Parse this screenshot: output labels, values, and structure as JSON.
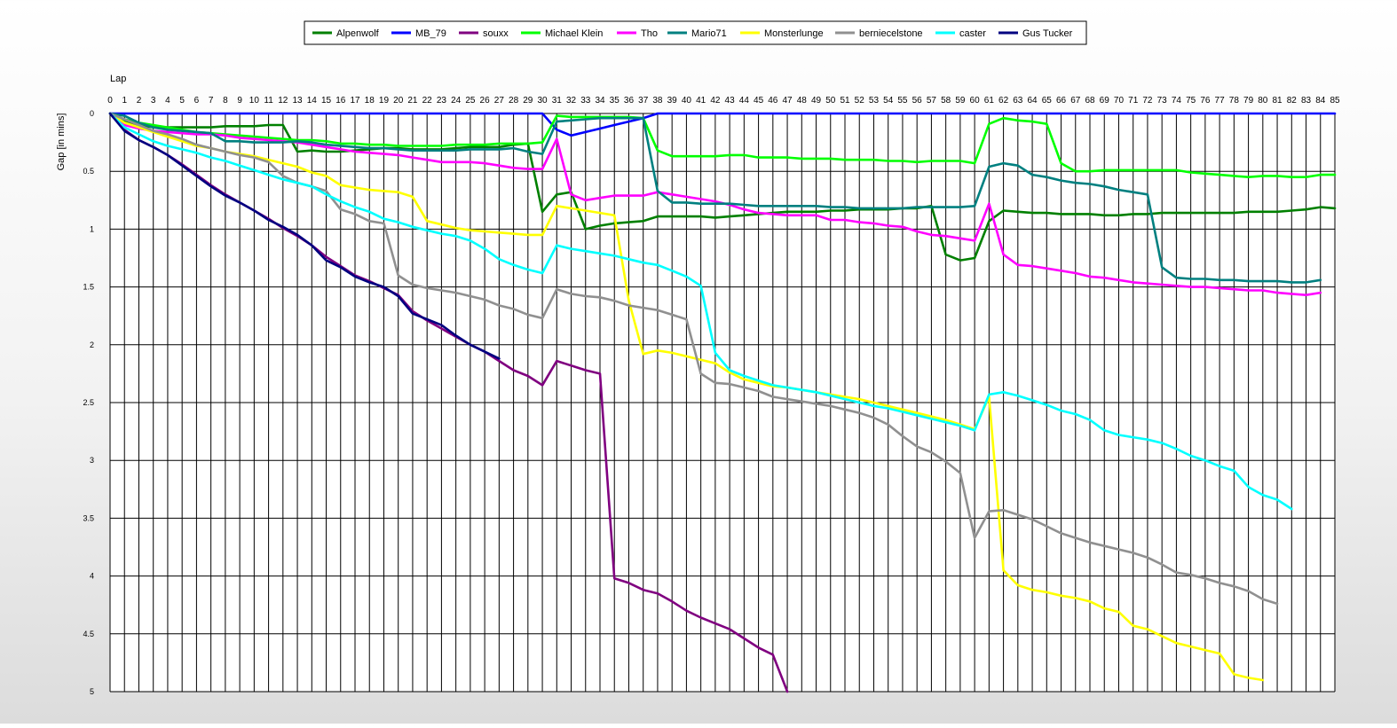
{
  "chart_data": {
    "type": "line",
    "title": "",
    "xlabel": "Lap",
    "ylabel": "Gap [in mins]",
    "x_ticks": [
      "0",
      "1",
      "2",
      "3",
      "4",
      "5",
      "6",
      "7",
      "8",
      "9",
      "10",
      "11",
      "12",
      "13",
      "14",
      "15",
      "16",
      "17",
      "18",
      "19",
      "20",
      "21",
      "22",
      "23",
      "24",
      "25",
      "26",
      "27",
      "28",
      "29",
      "30",
      "31",
      "32",
      "33",
      "34",
      "35",
      "36",
      "37",
      "38",
      "39",
      "40",
      "41",
      "42",
      "43",
      "44",
      "45",
      "46",
      "47",
      "48",
      "49",
      "50",
      "51",
      "52",
      "53",
      "54",
      "55",
      "56",
      "57",
      "58",
      "59",
      "60",
      "61",
      "62",
      "63",
      "64",
      "65",
      "66",
      "67",
      "68",
      "69",
      "70",
      "71",
      "72",
      "73",
      "74",
      "75",
      "76",
      "77",
      "78",
      "79",
      "80",
      "81",
      "82",
      "83",
      "84",
      "85"
    ],
    "y_ticks": [
      "0",
      "0.5",
      "1",
      "1.5",
      "2",
      "2.5",
      "3",
      "3.5",
      "4",
      "4.5",
      "5"
    ],
    "xlim": [
      0,
      85
    ],
    "ylim": [
      0,
      5
    ],
    "y_inverted": true,
    "grid": true,
    "legend_position": "top-center",
    "series": [
      {
        "name": "Alpenwolf",
        "color": "#008000",
        "values": [
          0,
          0.07,
          0.1,
          0.12,
          0.12,
          0.12,
          0.12,
          0.12,
          0.11,
          0.11,
          0.11,
          0.1,
          0.1,
          0.33,
          0.32,
          0.33,
          0.33,
          0.32,
          0.31,
          0.3,
          0.3,
          0.31,
          0.31,
          0.31,
          0.3,
          0.29,
          0.29,
          0.29,
          0.27,
          0.26,
          0.85,
          0.7,
          0.68,
          1,
          0.97,
          0.95,
          0.94,
          0.93,
          0.89,
          0.89,
          0.89,
          0.89,
          0.9,
          0.89,
          0.88,
          0.87,
          0.86,
          0.85,
          0.85,
          0.85,
          0.84,
          0.84,
          0.83,
          0.83,
          0.83,
          0.82,
          0.82,
          0.8,
          1.22,
          1.27,
          1.25,
          0.93,
          0.84,
          0.85,
          0.86,
          0.86,
          0.87,
          0.87,
          0.87,
          0.88,
          0.88,
          0.87,
          0.87,
          0.86,
          0.86,
          0.86,
          0.86,
          0.86,
          0.86,
          0.85,
          0.85,
          0.85,
          0.84,
          0.83,
          0.81,
          0.82
        ]
      },
      {
        "name": "MB_79",
        "color": "#0000ff",
        "values": [
          0,
          0,
          0,
          0,
          0,
          0,
          0,
          0,
          0,
          0,
          0,
          0,
          0,
          0,
          0,
          0,
          0,
          0,
          0,
          0,
          0,
          0,
          0,
          0,
          0,
          0,
          0,
          0,
          0,
          0,
          0,
          0.14,
          0.19,
          0.16,
          0.13,
          0.1,
          0.07,
          0.04,
          0,
          0,
          0,
          0,
          0,
          0,
          0,
          0,
          0,
          0,
          0,
          0,
          0,
          0,
          0,
          0,
          0,
          0,
          0,
          0,
          0,
          0,
          0,
          0,
          0,
          0,
          0,
          0,
          0,
          0,
          0,
          0,
          0,
          0,
          0,
          0,
          0,
          0,
          0,
          0,
          0,
          0,
          0,
          0,
          0,
          0,
          0,
          0
        ]
      },
      {
        "name": "souxx",
        "color": "#800080",
        "values": [
          0,
          0.14,
          0.23,
          0.29,
          0.36,
          0.44,
          0.53,
          0.62,
          0.7,
          0.77,
          0.84,
          0.91,
          0.99,
          1.06,
          1.14,
          1.24,
          1.32,
          1.4,
          1.45,
          1.51,
          1.57,
          1.71,
          1.79,
          1.86,
          1.93,
          2,
          2.06,
          2.14,
          2.22,
          2.27,
          2.35,
          2.14,
          2.18,
          2.22,
          2.25,
          4.02,
          4.06,
          4.12,
          4.15,
          4.22,
          4.3,
          4.36,
          4.41,
          4.46,
          4.54,
          4.62,
          4.68,
          5.0
        ]
      },
      {
        "name": "Michael Klein",
        "color": "#00ff00",
        "values": [
          0,
          0.05,
          0.08,
          0.1,
          0.12,
          0.14,
          0.16,
          0.17,
          0.18,
          0.19,
          0.2,
          0.21,
          0.22,
          0.23,
          0.23,
          0.24,
          0.26,
          0.26,
          0.27,
          0.27,
          0.28,
          0.28,
          0.28,
          0.28,
          0.27,
          0.27,
          0.27,
          0.26,
          0.26,
          0.26,
          0.25,
          0.02,
          0.03,
          0.03,
          0.03,
          0.03,
          0.03,
          0.04,
          0.32,
          0.37,
          0.37,
          0.37,
          0.37,
          0.36,
          0.36,
          0.38,
          0.38,
          0.38,
          0.39,
          0.39,
          0.39,
          0.4,
          0.4,
          0.4,
          0.41,
          0.41,
          0.42,
          0.41,
          0.41,
          0.41,
          0.43,
          0.09,
          0.04,
          0.06,
          0.07,
          0.09,
          0.43,
          0.5,
          0.5,
          0.49,
          0.49,
          0.49,
          0.49,
          0.49,
          0.49,
          0.51,
          0.52,
          0.53,
          0.54,
          0.55,
          0.54,
          0.54,
          0.55,
          0.55,
          0.53,
          0.53
        ]
      },
      {
        "name": "Tho",
        "color": "#ff00ff",
        "values": [
          0,
          0.1,
          0.13,
          0.15,
          0.16,
          0.17,
          0.18,
          0.18,
          0.19,
          0.21,
          0.22,
          0.23,
          0.24,
          0.25,
          0.27,
          0.29,
          0.31,
          0.33,
          0.34,
          0.35,
          0.36,
          0.38,
          0.4,
          0.42,
          0.42,
          0.42,
          0.43,
          0.45,
          0.47,
          0.48,
          0.48,
          0.22,
          0.7,
          0.75,
          0.73,
          0.71,
          0.71,
          0.71,
          0.68,
          0.7,
          0.72,
          0.74,
          0.76,
          0.79,
          0.83,
          0.86,
          0.87,
          0.88,
          0.88,
          0.88,
          0.92,
          0.92,
          0.94,
          0.95,
          0.97,
          0.98,
          1.02,
          1.05,
          1.06,
          1.08,
          1.1,
          0.78,
          1.22,
          1.31,
          1.32,
          1.34,
          1.36,
          1.38,
          1.41,
          1.42,
          1.44,
          1.46,
          1.47,
          1.48,
          1.49,
          1.5,
          1.5,
          1.51,
          1.52,
          1.53,
          1.53,
          1.55,
          1.56,
          1.57,
          1.55
        ]
      },
      {
        "name": "Mario71",
        "color": "#008080",
        "values": [
          0,
          0.02,
          0.08,
          0.12,
          0.14,
          0.15,
          0.16,
          0.17,
          0.24,
          0.24,
          0.25,
          0.25,
          0.25,
          0.24,
          0.25,
          0.27,
          0.28,
          0.29,
          0.3,
          0.3,
          0.31,
          0.32,
          0.32,
          0.32,
          0.32,
          0.31,
          0.31,
          0.31,
          0.3,
          0.33,
          0.35,
          0.07,
          0.06,
          0.05,
          0.04,
          0.04,
          0.04,
          0.04,
          0.67,
          0.77,
          0.77,
          0.78,
          0.78,
          0.78,
          0.79,
          0.8,
          0.8,
          0.8,
          0.8,
          0.8,
          0.81,
          0.81,
          0.82,
          0.82,
          0.82,
          0.82,
          0.81,
          0.81,
          0.81,
          0.81,
          0.8,
          0.46,
          0.43,
          0.45,
          0.53,
          0.55,
          0.58,
          0.6,
          0.61,
          0.63,
          0.66,
          0.68,
          0.7,
          1.33,
          1.42,
          1.43,
          1.43,
          1.44,
          1.44,
          1.45,
          1.45,
          1.45,
          1.46,
          1.46,
          1.44
        ]
      },
      {
        "name": "Monsterlunge",
        "color": "#ffff00",
        "values": [
          0,
          0.08,
          0.12,
          0.16,
          0.2,
          0.24,
          0.28,
          0.3,
          0.33,
          0.35,
          0.37,
          0.4,
          0.43,
          0.46,
          0.51,
          0.54,
          0.62,
          0.64,
          0.66,
          0.67,
          0.68,
          0.72,
          0.93,
          0.96,
          0.99,
          1.01,
          1.02,
          1.03,
          1.04,
          1.05,
          1.05,
          0.8,
          0.82,
          0.84,
          0.86,
          0.88,
          1.62,
          2.08,
          2.05,
          2.07,
          2.1,
          2.13,
          2.16,
          2.24,
          2.3,
          2.33,
          2.36,
          2.37,
          2.39,
          2.41,
          2.43,
          2.45,
          2.47,
          2.5,
          2.53,
          2.56,
          2.59,
          2.62,
          2.65,
          2.69,
          2.73,
          2.45,
          3.95,
          4.08,
          4.12,
          4.14,
          4.17,
          4.19,
          4.22,
          4.28,
          4.31,
          4.43,
          4.46,
          4.52,
          4.58,
          4.61,
          4.64,
          4.67,
          4.85,
          4.88,
          4.9
        ]
      },
      {
        "name": "berniecelstone",
        "color": "#909090",
        "values": [
          0,
          0.05,
          0.1,
          0.15,
          0.18,
          0.22,
          0.27,
          0.3,
          0.33,
          0.36,
          0.38,
          0.42,
          0.54,
          0.6,
          0.63,
          0.67,
          0.83,
          0.87,
          0.93,
          0.95,
          1.4,
          1.48,
          1.51,
          1.53,
          1.55,
          1.58,
          1.61,
          1.66,
          1.69,
          1.74,
          1.77,
          1.52,
          1.56,
          1.58,
          1.59,
          1.62,
          1.66,
          1.68,
          1.7,
          1.74,
          1.78,
          2.25,
          2.33,
          2.34,
          2.37,
          2.4,
          2.45,
          2.47,
          2.49,
          2.51,
          2.53,
          2.56,
          2.59,
          2.63,
          2.69,
          2.79,
          2.88,
          2.93,
          3.01,
          3.11,
          3.67,
          3.44,
          3.43,
          3.47,
          3.51,
          3.57,
          3.63,
          3.67,
          3.71,
          3.74,
          3.77,
          3.8,
          3.84,
          3.9,
          3.97,
          3.99,
          4.02,
          4.06,
          4.09,
          4.13,
          4.2,
          4.24
        ]
      },
      {
        "name": "caster",
        "color": "#00ffff",
        "values": [
          0,
          0.12,
          0.18,
          0.24,
          0.28,
          0.31,
          0.34,
          0.38,
          0.41,
          0.45,
          0.49,
          0.53,
          0.57,
          0.6,
          0.63,
          0.7,
          0.76,
          0.81,
          0.85,
          0.91,
          0.94,
          0.98,
          1.01,
          1.04,
          1.06,
          1.1,
          1.17,
          1.26,
          1.31,
          1.35,
          1.38,
          1.14,
          1.17,
          1.19,
          1.21,
          1.23,
          1.26,
          1.29,
          1.31,
          1.36,
          1.41,
          1.49,
          2.07,
          2.22,
          2.27,
          2.31,
          2.35,
          2.37,
          2.39,
          2.41,
          2.44,
          2.47,
          2.5,
          2.53,
          2.55,
          2.58,
          2.61,
          2.64,
          2.67,
          2.7,
          2.74,
          2.43,
          2.41,
          2.44,
          2.48,
          2.52,
          2.57,
          2.6,
          2.65,
          2.74,
          2.78,
          2.8,
          2.82,
          2.85,
          2.9,
          2.96,
          3.0,
          3.05,
          3.09,
          3.23,
          3.3,
          3.34,
          3.42
        ]
      },
      {
        "name": "Gus Tucker",
        "color": "#000080",
        "values": [
          0,
          0.15,
          0.23,
          0.29,
          0.36,
          0.45,
          0.54,
          0.63,
          0.71,
          0.77,
          0.84,
          0.92,
          0.98,
          1.05,
          1.14,
          1.27,
          1.33,
          1.41,
          1.46,
          1.5,
          1.58,
          1.73,
          1.78,
          1.83,
          1.92,
          2,
          2.06,
          2.12
        ]
      }
    ]
  }
}
